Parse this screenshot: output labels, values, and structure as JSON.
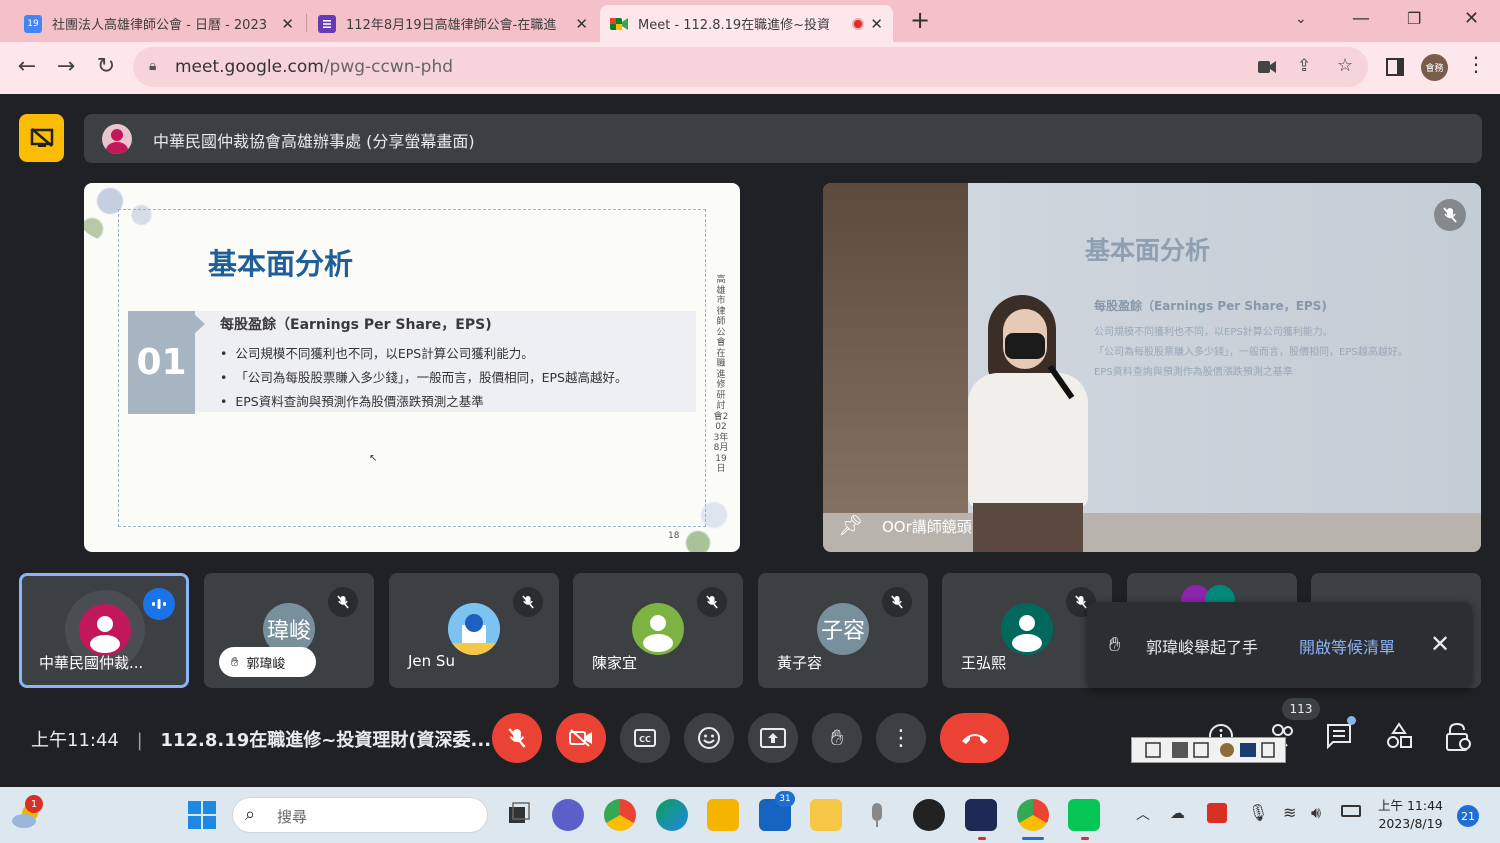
{
  "browser": {
    "tabs": [
      {
        "title": "社團法人高雄律師公會 - 日曆 - 2023",
        "favicon": "calendar-icon",
        "favicon_text": "19"
      },
      {
        "title": "112年8月19日高雄律師公會-在職進",
        "favicon": "forms-icon"
      },
      {
        "title": "Meet - 112.8.19在職進修~投資",
        "favicon": "meet-icon"
      }
    ],
    "url_host": "meet.google.com",
    "url_path": "/pwg-ccwn-phd",
    "profile_label": "會務"
  },
  "meet": {
    "presenter_banner": "中華民國仲裁協會高雄辦事處 (分享螢幕畫面)",
    "slide": {
      "title": "基本面分析",
      "number": "01",
      "heading": "每股盈餘（Earnings Per Share，EPS)",
      "bullets": [
        "公司規模不同獲利也不同，以EPS計算公司獲利能力。",
        "「公司為每股股票賺入多少錢」，一般而言，股價相同，EPS越高越好。",
        "EPS資料查詢與預測作為股價漲跌預測之基準"
      ],
      "vertical_text": "高雄市律師公會在職進修研討會2023年8月19日",
      "page_number": "18"
    },
    "camera_tile": {
      "label": "OOr講師鏡頭",
      "slide_title": "基本面分析",
      "slide_heading": "每股盈餘（Earnings Per Share，EPS)",
      "slide_bullets": [
        "公司規模不同獲利也不同，以EPS計算公司獲利能力。",
        "「公司為每股股票賺入多少錢」，一般而言，股價相同，EPS越高越好。",
        "EPS資料查詢與預測作為股價漲跌預測之基準"
      ]
    },
    "participants": [
      {
        "name": "中華民國仲裁...",
        "avatar_text": "",
        "avatar_color": "#c2185b"
      },
      {
        "name": "",
        "avatar_text": "瑋峻",
        "avatar_color": "#78909c",
        "hand_label": "郭瑋峻"
      },
      {
        "name": "Jen Su",
        "avatar_text": "",
        "avatar_color": "#5b9bd5"
      },
      {
        "name": "陳家宜",
        "avatar_text": "",
        "avatar_color": "#7cb342"
      },
      {
        "name": "黃子容",
        "avatar_text": "子容",
        "avatar_color": "#78909c"
      },
      {
        "name": "王弘熙",
        "avatar_text": "",
        "avatar_color": "#00695c"
      }
    ],
    "toast": {
      "message": "郭瑋峻舉起了手",
      "action": "開啟等候清單"
    },
    "controls": {
      "time": "上午11:44",
      "meeting_title": "112.8.19在職進修~投資理財(資深委...",
      "people_count": "113"
    }
  },
  "taskbar": {
    "search_placeholder": "搜尋",
    "weather_badge": "1",
    "mail_badge": "31",
    "clock_time": "上午 11:44",
    "clock_date": "2023/8/19",
    "notification_count": "21"
  }
}
